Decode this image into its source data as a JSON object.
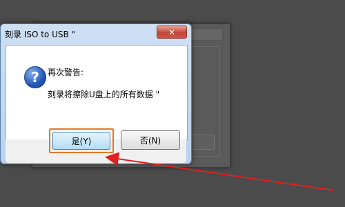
{
  "dialog": {
    "title": "刻录 ISO to USB \"",
    "close_label": "✕",
    "message_title": "再次警告:",
    "message_body": "刻录将擦除U盘上的所有数据 \"",
    "buttons": {
      "yes": "是(Y)",
      "no": "否(N)"
    },
    "icon": "question-icon"
  },
  "background_window": {
    "visible": true
  },
  "annotation": {
    "type": "arrow",
    "color": "#e02020",
    "points_to": "yes-button"
  }
}
